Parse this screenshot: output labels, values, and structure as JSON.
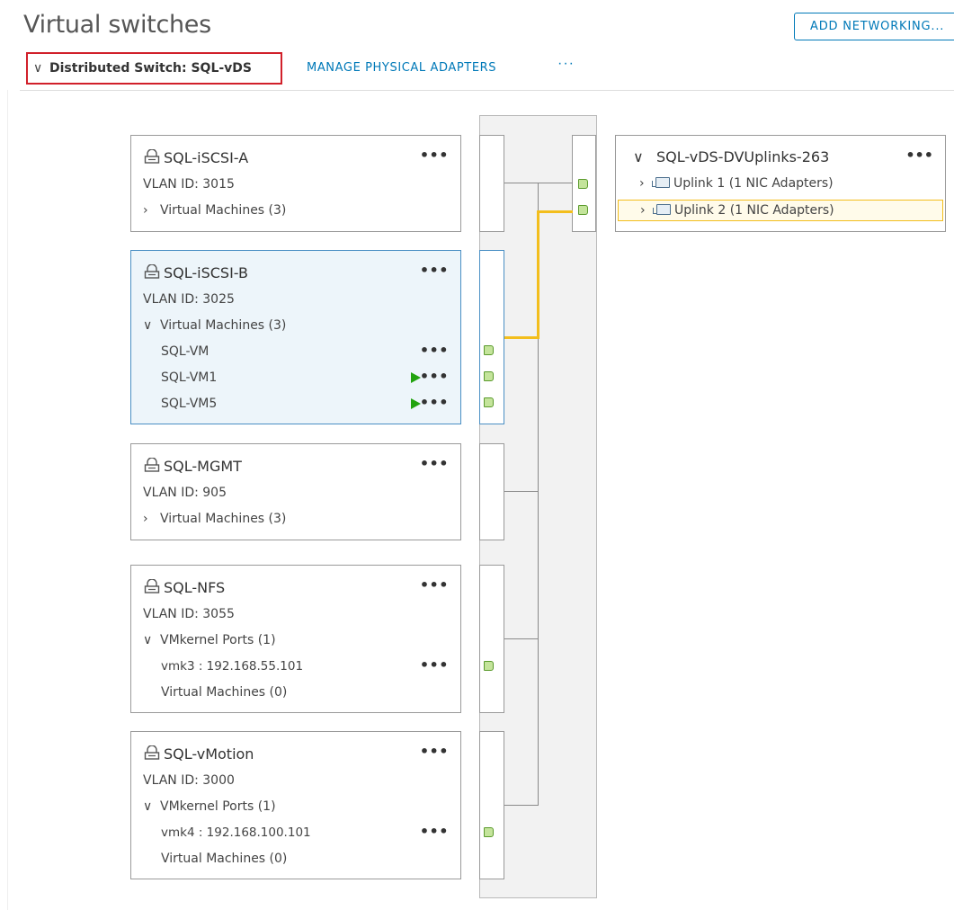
{
  "header": {
    "title": "Virtual switches",
    "add_networking": "ADD NETWORKING..."
  },
  "toolbar": {
    "switch_chevron": "∨",
    "switch_label": "Distributed Switch: SQL-vDS",
    "manage_adapters": "MANAGE PHYSICAL ADAPTERS",
    "more": "···"
  },
  "port_groups": [
    {
      "name": "SQL-iSCSI-A",
      "vlan": "VLAN ID: 3015",
      "section_chevron": "›",
      "section_label": "Virtual Machines (3)"
    },
    {
      "name": "SQL-iSCSI-B",
      "vlan": "VLAN ID: 3025",
      "section_chevron": "∨",
      "section_label": "Virtual Machines (3)",
      "vms": [
        {
          "name": "SQL-VM",
          "powered_on": false
        },
        {
          "name": "SQL-VM1",
          "powered_on": true
        },
        {
          "name": "SQL-VM5",
          "powered_on": true
        }
      ]
    },
    {
      "name": "SQL-MGMT",
      "vlan": "VLAN ID: 905",
      "section_chevron": "›",
      "section_label": "Virtual Machines (3)"
    },
    {
      "name": "SQL-NFS",
      "vlan": "VLAN ID: 3055",
      "section_chevron": "∨",
      "section_label": "VMkernel Ports (1)",
      "vmk": "vmk3 : 192.168.55.101",
      "vm_label": "Virtual Machines (0)"
    },
    {
      "name": "SQL-vMotion",
      "vlan": "VLAN ID: 3000",
      "section_chevron": "∨",
      "section_label": "VMkernel Ports (1)",
      "vmk": "vmk4 : 192.168.100.101",
      "vm_label": "Virtual Machines (0)"
    }
  ],
  "uplinks": {
    "chevron": "∨",
    "name": "SQL-vDS-DVUplinks-263",
    "items": [
      {
        "chevron": "›",
        "label": "Uplink 1 (1 NIC Adapters)",
        "highlighted": false
      },
      {
        "chevron": "›",
        "label": "Uplink 2 (1 NIC Adapters)",
        "highlighted": true
      }
    ]
  },
  "more_glyph": "•••",
  "colors": {
    "accent": "#0079b8",
    "highlight_wire": "#f3be1d",
    "port_green": "#c4e49b",
    "play_green": "#22a30f",
    "selection_border": "#d1202a"
  },
  "icons": {
    "port_group": "network-port-group-icon",
    "nic": "physical-nic-icon",
    "power_on": "play-icon"
  }
}
